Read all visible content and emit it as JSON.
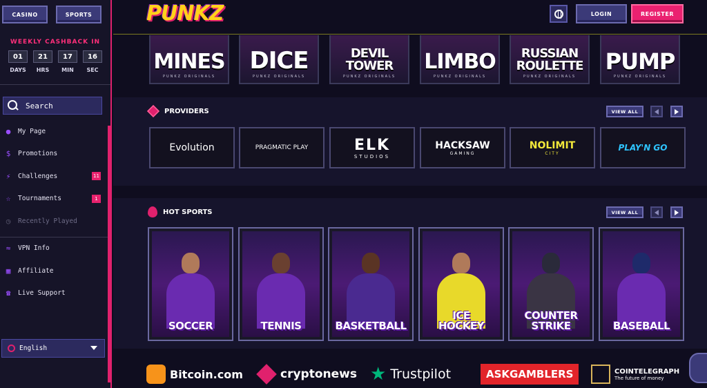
{
  "sidebar": {
    "casino_label": "CASINO",
    "sports_label": "SPORTS",
    "cashback_title": "WEEKLY CASHBACK IN",
    "countdown": {
      "days": "01",
      "hrs": "21",
      "min": "17",
      "sec": "16"
    },
    "units": {
      "days": "DAYS",
      "hrs": "HRS",
      "min": "MIN",
      "sec": "SEC"
    },
    "search_label": "Search",
    "items": [
      {
        "label": "My Page",
        "icon": "user-icon"
      },
      {
        "label": "Promotions",
        "icon": "coin-icon"
      },
      {
        "label": "Challenges",
        "icon": "lightning-icon",
        "badge": "11"
      },
      {
        "label": "Tournaments",
        "icon": "trophy-icon",
        "badge": "1"
      },
      {
        "label": "Recently Played",
        "icon": "clock-icon"
      }
    ],
    "items2": [
      {
        "label": "VPN Info",
        "icon": "wifi-icon"
      },
      {
        "label": "Affiliate",
        "icon": "gift-icon"
      },
      {
        "label": "Live Support",
        "icon": "headset-icon"
      }
    ],
    "language": "English"
  },
  "header": {
    "logo": "PUNKZ",
    "login_label": "LOGIN",
    "register_label": "REGISTER"
  },
  "originals": {
    "sub": "PUNKZ ORIGINALS",
    "items": [
      "MINES",
      "DICE",
      "DEVIL TOWER",
      "LIMBO",
      "RUSSIAN ROULETTE",
      "PUMP"
    ]
  },
  "providers": {
    "title": "PROVIDERS",
    "view_all": "VIEW ALL",
    "items": [
      "Evolution",
      "PRAGMATIC PLAY",
      "ELK",
      "HACKSAW",
      "NOLIMIT",
      "PLAY'N GO"
    ],
    "subs": [
      "",
      "",
      "STUDIOS",
      "GAMING",
      "CITY",
      ""
    ]
  },
  "hot_sports": {
    "title": "HOT SPORTS",
    "view_all": "VIEW ALL",
    "items": [
      "SOCCER",
      "TENNIS",
      "BASKETBALL",
      "ICE HOCKEY",
      "COUNTER STRIKE",
      "BASEBALL"
    ]
  },
  "partners": {
    "items": [
      "Bitcoin.com",
      "cryptonews",
      "Trustpilot",
      "ASKGAMBLERS",
      "COINTELEGRAPH"
    ],
    "cointelegraph_sub": "The future of money"
  },
  "colors": {
    "accent": "#e0216d",
    "button": "#3b3a78",
    "logo": "#ffd21a"
  }
}
